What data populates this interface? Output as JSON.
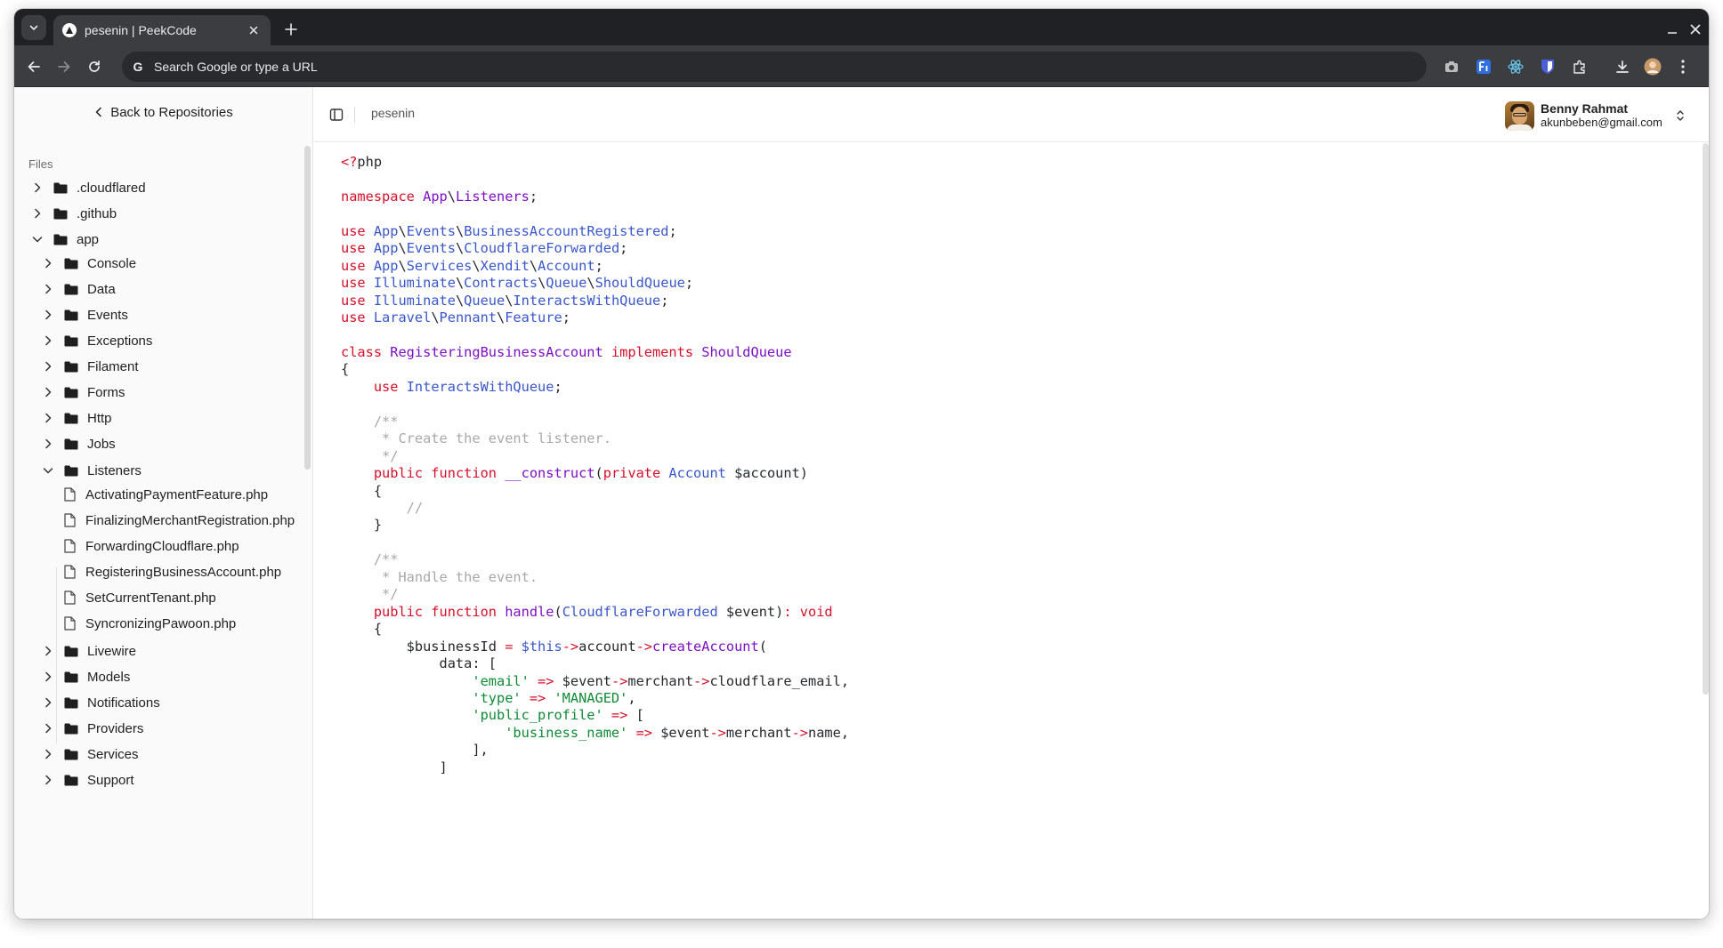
{
  "browser": {
    "tab_title": "pesenin | PeekCode",
    "omnibox_placeholder": "Search Google or type a URL"
  },
  "sidebar": {
    "back_label": "Back to Repositories",
    "files_label": "Files",
    "tree": [
      {
        "label": ".cloudflared",
        "type": "folder",
        "expanded": false,
        "depth": 0
      },
      {
        "label": ".github",
        "type": "folder",
        "expanded": false,
        "depth": 0
      },
      {
        "label": "app",
        "type": "folder",
        "expanded": true,
        "depth": 0
      },
      {
        "label": "Console",
        "type": "folder",
        "expanded": false,
        "depth": 1
      },
      {
        "label": "Data",
        "type": "folder",
        "expanded": false,
        "depth": 1
      },
      {
        "label": "Events",
        "type": "folder",
        "expanded": false,
        "depth": 1
      },
      {
        "label": "Exceptions",
        "type": "folder",
        "expanded": false,
        "depth": 1
      },
      {
        "label": "Filament",
        "type": "folder",
        "expanded": false,
        "depth": 1
      },
      {
        "label": "Forms",
        "type": "folder",
        "expanded": false,
        "depth": 1
      },
      {
        "label": "Http",
        "type": "folder",
        "expanded": false,
        "depth": 1
      },
      {
        "label": "Jobs",
        "type": "folder",
        "expanded": false,
        "depth": 1
      },
      {
        "label": "Listeners",
        "type": "folder",
        "expanded": true,
        "depth": 1
      },
      {
        "label": "ActivatingPaymentFeature.php",
        "type": "file",
        "depth": 2
      },
      {
        "label": "FinalizingMerchantRegistration.php",
        "type": "file",
        "depth": 2
      },
      {
        "label": "ForwardingCloudflare.php",
        "type": "file",
        "depth": 2
      },
      {
        "label": "RegisteringBusinessAccount.php",
        "type": "file",
        "depth": 2
      },
      {
        "label": "SetCurrentTenant.php",
        "type": "file",
        "depth": 2
      },
      {
        "label": "SyncronizingPawoon.php",
        "type": "file",
        "depth": 2
      },
      {
        "label": "Livewire",
        "type": "folder",
        "expanded": false,
        "depth": 1
      },
      {
        "label": "Models",
        "type": "folder",
        "expanded": false,
        "depth": 1
      },
      {
        "label": "Notifications",
        "type": "folder",
        "expanded": false,
        "depth": 1
      },
      {
        "label": "Providers",
        "type": "folder",
        "expanded": false,
        "depth": 1
      },
      {
        "label": "Services",
        "type": "folder",
        "expanded": false,
        "depth": 1
      },
      {
        "label": "Support",
        "type": "folder",
        "expanded": false,
        "depth": 1
      }
    ]
  },
  "header": {
    "breadcrumb": "pesenin",
    "user_name": "Benny Rahmat",
    "user_email": "akunbeben@gmail.com"
  },
  "code": {
    "language": "php",
    "lines": [
      [
        [
          "ph",
          "<?"
        ],
        [
          "pl",
          "php"
        ]
      ],
      [],
      [
        [
          "kw",
          "namespace "
        ],
        [
          "cl",
          "App"
        ],
        [
          "pl",
          "\\"
        ],
        [
          "cl",
          "Listeners"
        ],
        [
          "pl",
          ";"
        ]
      ],
      [],
      [
        [
          "kw",
          "use "
        ],
        [
          "ns",
          "App"
        ],
        [
          "pl",
          "\\"
        ],
        [
          "ns",
          "Events"
        ],
        [
          "pl",
          "\\"
        ],
        [
          "ns",
          "BusinessAccountRegistered"
        ],
        [
          "pl",
          ";"
        ]
      ],
      [
        [
          "kw",
          "use "
        ],
        [
          "ns",
          "App"
        ],
        [
          "pl",
          "\\"
        ],
        [
          "ns",
          "Events"
        ],
        [
          "pl",
          "\\"
        ],
        [
          "ns",
          "CloudflareForwarded"
        ],
        [
          "pl",
          ";"
        ]
      ],
      [
        [
          "kw",
          "use "
        ],
        [
          "ns",
          "App"
        ],
        [
          "pl",
          "\\"
        ],
        [
          "ns",
          "Services"
        ],
        [
          "pl",
          "\\"
        ],
        [
          "ns",
          "Xendit"
        ],
        [
          "pl",
          "\\"
        ],
        [
          "ns",
          "Account"
        ],
        [
          "pl",
          ";"
        ]
      ],
      [
        [
          "kw",
          "use "
        ],
        [
          "ns",
          "Illuminate"
        ],
        [
          "pl",
          "\\"
        ],
        [
          "ns",
          "Contracts"
        ],
        [
          "pl",
          "\\"
        ],
        [
          "ns",
          "Queue"
        ],
        [
          "pl",
          "\\"
        ],
        [
          "ns",
          "ShouldQueue"
        ],
        [
          "pl",
          ";"
        ]
      ],
      [
        [
          "kw",
          "use "
        ],
        [
          "ns",
          "Illuminate"
        ],
        [
          "pl",
          "\\"
        ],
        [
          "ns",
          "Queue"
        ],
        [
          "pl",
          "\\"
        ],
        [
          "ns",
          "InteractsWithQueue"
        ],
        [
          "pl",
          ";"
        ]
      ],
      [
        [
          "kw",
          "use "
        ],
        [
          "ns",
          "Laravel"
        ],
        [
          "pl",
          "\\"
        ],
        [
          "ns",
          "Pennant"
        ],
        [
          "pl",
          "\\"
        ],
        [
          "ns",
          "Feature"
        ],
        [
          "pl",
          ";"
        ]
      ],
      [],
      [
        [
          "kw",
          "class "
        ],
        [
          "cl",
          "RegisteringBusinessAccount"
        ],
        [
          "kw",
          " implements "
        ],
        [
          "cl",
          "ShouldQueue"
        ]
      ],
      [
        [
          "pl",
          "{"
        ]
      ],
      [
        [
          "pl",
          "    "
        ],
        [
          "kw",
          "use "
        ],
        [
          "ns",
          "InteractsWithQueue"
        ],
        [
          "pl",
          ";"
        ]
      ],
      [],
      [
        [
          "cm",
          "    /**"
        ]
      ],
      [
        [
          "cm",
          "     * Create the event listener."
        ]
      ],
      [
        [
          "cm",
          "     */"
        ]
      ],
      [
        [
          "pl",
          "    "
        ],
        [
          "kw",
          "public function "
        ],
        [
          "fn",
          "__construct"
        ],
        [
          "pl",
          "("
        ],
        [
          "kw",
          "private "
        ],
        [
          "ns",
          "Account"
        ],
        [
          "pl",
          " $account)"
        ]
      ],
      [
        [
          "pl",
          "    {"
        ]
      ],
      [
        [
          "cm",
          "        //"
        ]
      ],
      [
        [
          "pl",
          "    }"
        ]
      ],
      [],
      [
        [
          "cm",
          "    /**"
        ]
      ],
      [
        [
          "cm",
          "     * Handle the event."
        ]
      ],
      [
        [
          "cm",
          "     */"
        ]
      ],
      [
        [
          "pl",
          "    "
        ],
        [
          "kw",
          "public function "
        ],
        [
          "fn",
          "handle"
        ],
        [
          "pl",
          "("
        ],
        [
          "ns",
          "CloudflareForwarded"
        ],
        [
          "pl",
          " $event)"
        ],
        [
          "op",
          ": "
        ],
        [
          "kw",
          "void"
        ]
      ],
      [
        [
          "pl",
          "    {"
        ]
      ],
      [
        [
          "pl",
          "        $businessId "
        ],
        [
          "op",
          "= "
        ],
        [
          "va",
          "$this"
        ],
        [
          "op",
          "->"
        ],
        [
          "pl",
          "account"
        ],
        [
          "op",
          "->"
        ],
        [
          "fn",
          "createAccount"
        ],
        [
          "pl",
          "("
        ]
      ],
      [
        [
          "pl",
          "            data: ["
        ]
      ],
      [
        [
          "pl",
          "                "
        ],
        [
          "st",
          "'email'"
        ],
        [
          "op",
          " => "
        ],
        [
          "pl",
          "$event"
        ],
        [
          "op",
          "->"
        ],
        [
          "pl",
          "merchant"
        ],
        [
          "op",
          "->"
        ],
        [
          "pl",
          "cloudflare_email,"
        ]
      ],
      [
        [
          "pl",
          "                "
        ],
        [
          "st",
          "'type'"
        ],
        [
          "op",
          " => "
        ],
        [
          "st",
          "'MANAGED'"
        ],
        [
          "pl",
          ","
        ]
      ],
      [
        [
          "pl",
          "                "
        ],
        [
          "st",
          "'public_profile'"
        ],
        [
          "op",
          " => "
        ],
        [
          "pl",
          "["
        ]
      ],
      [
        [
          "pl",
          "                    "
        ],
        [
          "st",
          "'business_name'"
        ],
        [
          "op",
          " => "
        ],
        [
          "pl",
          "$event"
        ],
        [
          "op",
          "->"
        ],
        [
          "pl",
          "merchant"
        ],
        [
          "op",
          "->"
        ],
        [
          "pl",
          "name,"
        ]
      ],
      [
        [
          "pl",
          "                ],"
        ]
      ],
      [
        [
          "pl",
          "            ]"
        ]
      ]
    ]
  }
}
